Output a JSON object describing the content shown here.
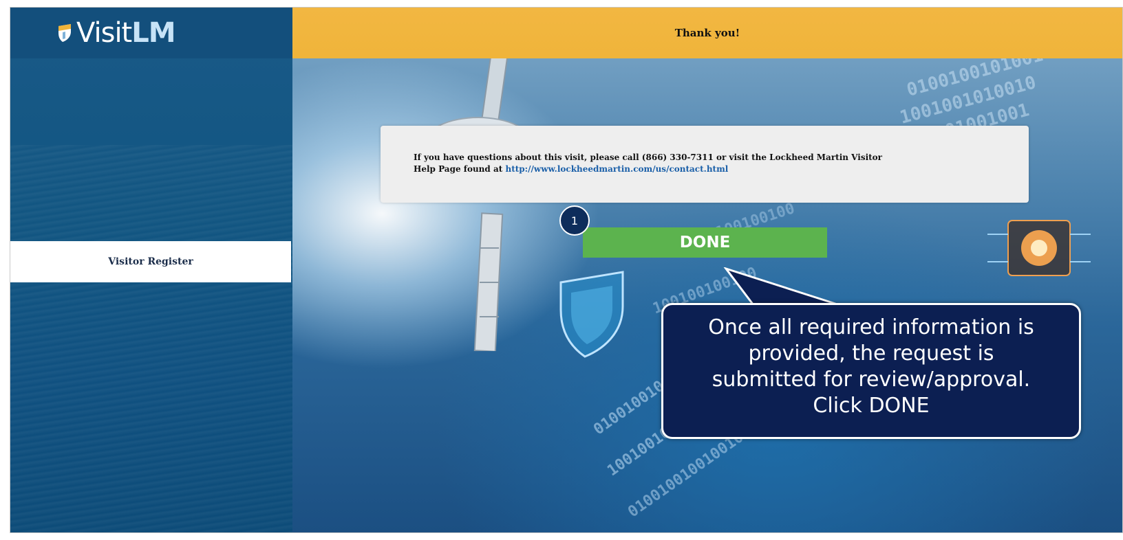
{
  "logo": {
    "prefix": "Visit",
    "suffix": "LM"
  },
  "sidebar": {
    "items": [
      {
        "label": "Visitor Register"
      }
    ]
  },
  "header": {
    "title": "Thank you!"
  },
  "info": {
    "line1": "If you have questions about this visit, please call (866) 330-7311 or visit the Lockheed Martin Visitor",
    "line2_prefix": "Help Page found at ",
    "link": "http://www.lockheedmartin.com/us/contact.html"
  },
  "done_button": {
    "label": "DONE"
  },
  "step_badge": {
    "number": "1"
  },
  "callout": {
    "line1": "Once all required information is",
    "line2": "provided, the request is",
    "line3": "submitted for review/approval.",
    "line4": "Click DONE"
  },
  "colors": {
    "header": "#f0b43a",
    "sidebar": "#115581",
    "done": "#5cb34e",
    "callout": "#0c1f52"
  }
}
